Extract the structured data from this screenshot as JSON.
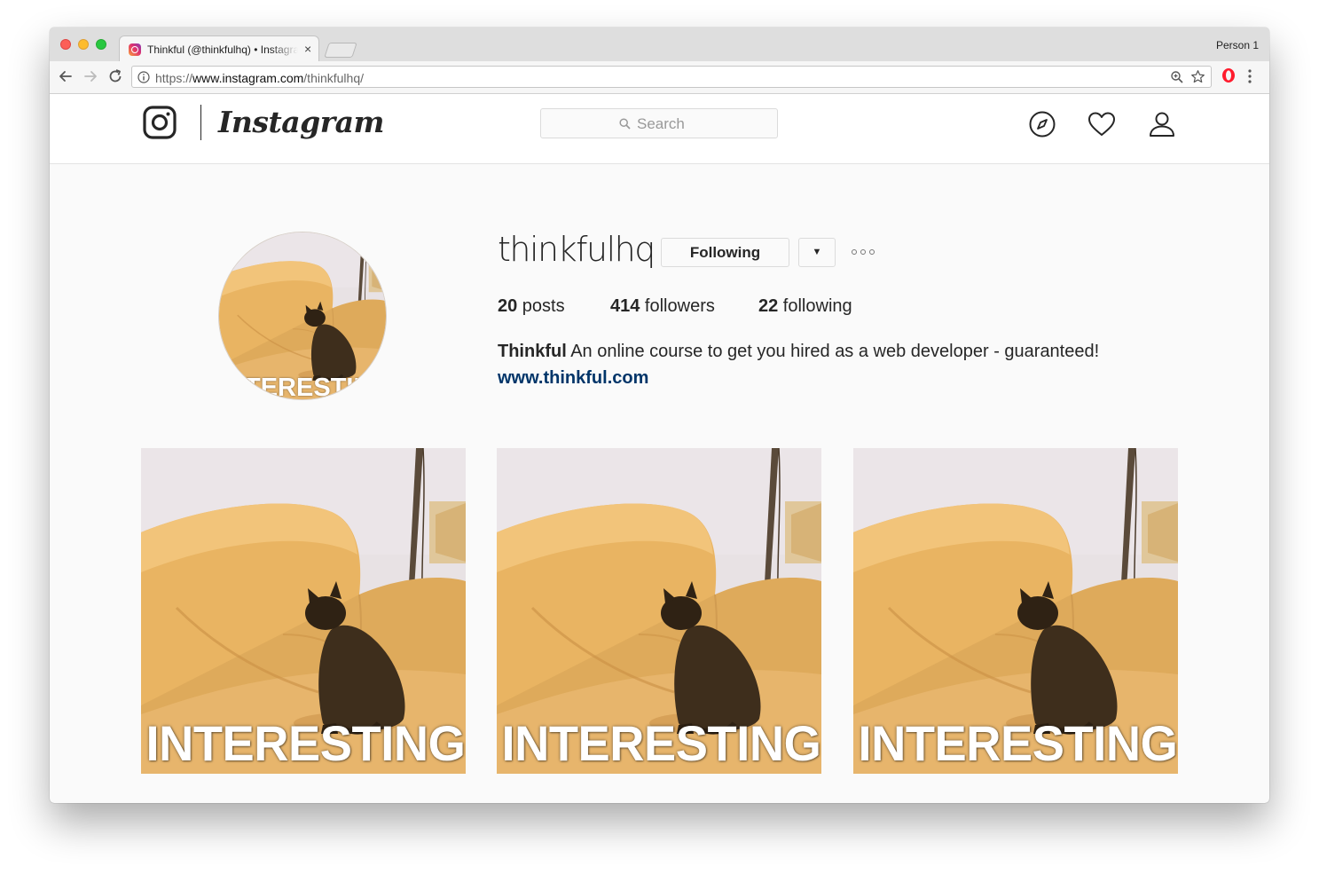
{
  "browser": {
    "tab_title": "Thinkful (@thinkfulhq) • Instagram",
    "tab_close": "×",
    "profile_name": "Person 1",
    "url_protocol": "https://",
    "url_host": "www.instagram.com",
    "url_path": "/thinkfulhq/"
  },
  "instagram": {
    "wordmark": "Instagram",
    "search_placeholder": "Search"
  },
  "profile": {
    "username": "thinkfulhq",
    "follow_button": "Following",
    "dropdown_symbol": "▼",
    "stats": {
      "posts_count": "20",
      "posts_label": " posts",
      "followers_count": "414",
      "followers_label": " followers",
      "following_count": "22",
      "following_label": " following"
    },
    "bio_name": "Thinkful",
    "bio_text": " An online course to get you hired as a web developer - guaranteed!",
    "website": "www.thinkful.com",
    "avatar_caption": "INTERESTING"
  },
  "posts": [
    {
      "caption": "INTERESTING"
    },
    {
      "caption": "INTERESTING"
    },
    {
      "caption": "INTERESTING"
    }
  ],
  "colors": {
    "link": "#003569",
    "text": "#262626",
    "sofa": "#e9b462",
    "cat": "#3e2e1c"
  }
}
